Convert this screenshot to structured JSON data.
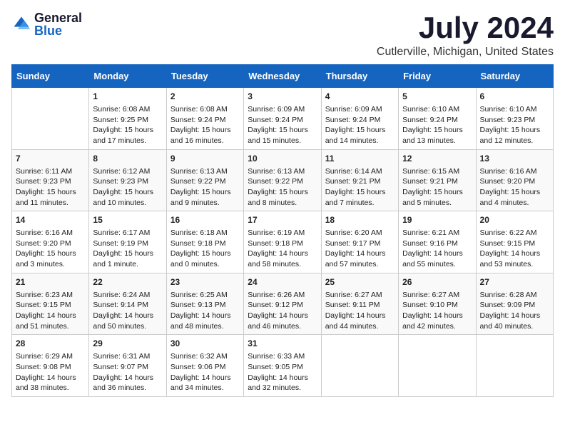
{
  "header": {
    "logo_general": "General",
    "logo_blue": "Blue",
    "month": "July 2024",
    "location": "Cutlerville, Michigan, United States"
  },
  "weekdays": [
    "Sunday",
    "Monday",
    "Tuesday",
    "Wednesday",
    "Thursday",
    "Friday",
    "Saturday"
  ],
  "weeks": [
    [
      {
        "day": "",
        "sunrise": "",
        "sunset": "",
        "daylight": ""
      },
      {
        "day": "1",
        "sunrise": "Sunrise: 6:08 AM",
        "sunset": "Sunset: 9:25 PM",
        "daylight": "Daylight: 15 hours and 17 minutes."
      },
      {
        "day": "2",
        "sunrise": "Sunrise: 6:08 AM",
        "sunset": "Sunset: 9:24 PM",
        "daylight": "Daylight: 15 hours and 16 minutes."
      },
      {
        "day": "3",
        "sunrise": "Sunrise: 6:09 AM",
        "sunset": "Sunset: 9:24 PM",
        "daylight": "Daylight: 15 hours and 15 minutes."
      },
      {
        "day": "4",
        "sunrise": "Sunrise: 6:09 AM",
        "sunset": "Sunset: 9:24 PM",
        "daylight": "Daylight: 15 hours and 14 minutes."
      },
      {
        "day": "5",
        "sunrise": "Sunrise: 6:10 AM",
        "sunset": "Sunset: 9:24 PM",
        "daylight": "Daylight: 15 hours and 13 minutes."
      },
      {
        "day": "6",
        "sunrise": "Sunrise: 6:10 AM",
        "sunset": "Sunset: 9:23 PM",
        "daylight": "Daylight: 15 hours and 12 minutes."
      }
    ],
    [
      {
        "day": "7",
        "sunrise": "Sunrise: 6:11 AM",
        "sunset": "Sunset: 9:23 PM",
        "daylight": "Daylight: 15 hours and 11 minutes."
      },
      {
        "day": "8",
        "sunrise": "Sunrise: 6:12 AM",
        "sunset": "Sunset: 9:23 PM",
        "daylight": "Daylight: 15 hours and 10 minutes."
      },
      {
        "day": "9",
        "sunrise": "Sunrise: 6:13 AM",
        "sunset": "Sunset: 9:22 PM",
        "daylight": "Daylight: 15 hours and 9 minutes."
      },
      {
        "day": "10",
        "sunrise": "Sunrise: 6:13 AM",
        "sunset": "Sunset: 9:22 PM",
        "daylight": "Daylight: 15 hours and 8 minutes."
      },
      {
        "day": "11",
        "sunrise": "Sunrise: 6:14 AM",
        "sunset": "Sunset: 9:21 PM",
        "daylight": "Daylight: 15 hours and 7 minutes."
      },
      {
        "day": "12",
        "sunrise": "Sunrise: 6:15 AM",
        "sunset": "Sunset: 9:21 PM",
        "daylight": "Daylight: 15 hours and 5 minutes."
      },
      {
        "day": "13",
        "sunrise": "Sunrise: 6:16 AM",
        "sunset": "Sunset: 9:20 PM",
        "daylight": "Daylight: 15 hours and 4 minutes."
      }
    ],
    [
      {
        "day": "14",
        "sunrise": "Sunrise: 6:16 AM",
        "sunset": "Sunset: 9:20 PM",
        "daylight": "Daylight: 15 hours and 3 minutes."
      },
      {
        "day": "15",
        "sunrise": "Sunrise: 6:17 AM",
        "sunset": "Sunset: 9:19 PM",
        "daylight": "Daylight: 15 hours and 1 minute."
      },
      {
        "day": "16",
        "sunrise": "Sunrise: 6:18 AM",
        "sunset": "Sunset: 9:18 PM",
        "daylight": "Daylight: 15 hours and 0 minutes."
      },
      {
        "day": "17",
        "sunrise": "Sunrise: 6:19 AM",
        "sunset": "Sunset: 9:18 PM",
        "daylight": "Daylight: 14 hours and 58 minutes."
      },
      {
        "day": "18",
        "sunrise": "Sunrise: 6:20 AM",
        "sunset": "Sunset: 9:17 PM",
        "daylight": "Daylight: 14 hours and 57 minutes."
      },
      {
        "day": "19",
        "sunrise": "Sunrise: 6:21 AM",
        "sunset": "Sunset: 9:16 PM",
        "daylight": "Daylight: 14 hours and 55 minutes."
      },
      {
        "day": "20",
        "sunrise": "Sunrise: 6:22 AM",
        "sunset": "Sunset: 9:15 PM",
        "daylight": "Daylight: 14 hours and 53 minutes."
      }
    ],
    [
      {
        "day": "21",
        "sunrise": "Sunrise: 6:23 AM",
        "sunset": "Sunset: 9:15 PM",
        "daylight": "Daylight: 14 hours and 51 minutes."
      },
      {
        "day": "22",
        "sunrise": "Sunrise: 6:24 AM",
        "sunset": "Sunset: 9:14 PM",
        "daylight": "Daylight: 14 hours and 50 minutes."
      },
      {
        "day": "23",
        "sunrise": "Sunrise: 6:25 AM",
        "sunset": "Sunset: 9:13 PM",
        "daylight": "Daylight: 14 hours and 48 minutes."
      },
      {
        "day": "24",
        "sunrise": "Sunrise: 6:26 AM",
        "sunset": "Sunset: 9:12 PM",
        "daylight": "Daylight: 14 hours and 46 minutes."
      },
      {
        "day": "25",
        "sunrise": "Sunrise: 6:27 AM",
        "sunset": "Sunset: 9:11 PM",
        "daylight": "Daylight: 14 hours and 44 minutes."
      },
      {
        "day": "26",
        "sunrise": "Sunrise: 6:27 AM",
        "sunset": "Sunset: 9:10 PM",
        "daylight": "Daylight: 14 hours and 42 minutes."
      },
      {
        "day": "27",
        "sunrise": "Sunrise: 6:28 AM",
        "sunset": "Sunset: 9:09 PM",
        "daylight": "Daylight: 14 hours and 40 minutes."
      }
    ],
    [
      {
        "day": "28",
        "sunrise": "Sunrise: 6:29 AM",
        "sunset": "Sunset: 9:08 PM",
        "daylight": "Daylight: 14 hours and 38 minutes."
      },
      {
        "day": "29",
        "sunrise": "Sunrise: 6:31 AM",
        "sunset": "Sunset: 9:07 PM",
        "daylight": "Daylight: 14 hours and 36 minutes."
      },
      {
        "day": "30",
        "sunrise": "Sunrise: 6:32 AM",
        "sunset": "Sunset: 9:06 PM",
        "daylight": "Daylight: 14 hours and 34 minutes."
      },
      {
        "day": "31",
        "sunrise": "Sunrise: 6:33 AM",
        "sunset": "Sunset: 9:05 PM",
        "daylight": "Daylight: 14 hours and 32 minutes."
      },
      {
        "day": "",
        "sunrise": "",
        "sunset": "",
        "daylight": ""
      },
      {
        "day": "",
        "sunrise": "",
        "sunset": "",
        "daylight": ""
      },
      {
        "day": "",
        "sunrise": "",
        "sunset": "",
        "daylight": ""
      }
    ]
  ]
}
